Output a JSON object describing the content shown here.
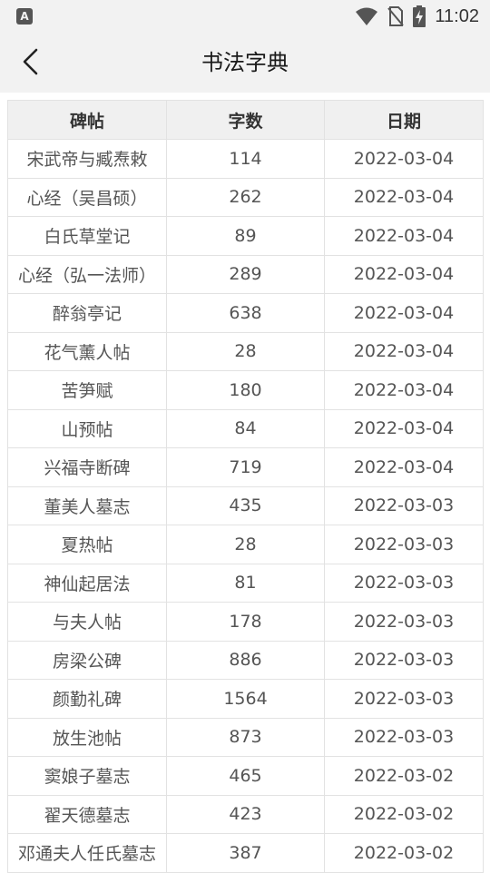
{
  "status_bar": {
    "app_badge": "A",
    "time": "11:02"
  },
  "header": {
    "title": "书法字典"
  },
  "table": {
    "columns": [
      "碑帖",
      "字数",
      "日期"
    ],
    "rows": [
      [
        "宋武帝与臧焘敕",
        "114",
        "2022-03-04"
      ],
      [
        "心经（吴昌硕）",
        "262",
        "2022-03-04"
      ],
      [
        "白氏草堂记",
        "89",
        "2022-03-04"
      ],
      [
        "心经（弘一法师）",
        "289",
        "2022-03-04"
      ],
      [
        "醉翁亭记",
        "638",
        "2022-03-04"
      ],
      [
        "花气薰人帖",
        "28",
        "2022-03-04"
      ],
      [
        "苦笋赋",
        "180",
        "2022-03-04"
      ],
      [
        "山预帖",
        "84",
        "2022-03-04"
      ],
      [
        "兴福寺断碑",
        "719",
        "2022-03-04"
      ],
      [
        "董美人墓志",
        "435",
        "2022-03-03"
      ],
      [
        "夏热帖",
        "28",
        "2022-03-03"
      ],
      [
        "神仙起居法",
        "81",
        "2022-03-03"
      ],
      [
        "与夫人帖",
        "178",
        "2022-03-03"
      ],
      [
        "房梁公碑",
        "886",
        "2022-03-03"
      ],
      [
        "颜勤礼碑",
        "1564",
        "2022-03-03"
      ],
      [
        "放生池帖",
        "873",
        "2022-03-03"
      ],
      [
        "窦娘子墓志",
        "465",
        "2022-03-02"
      ],
      [
        "翟天德墓志",
        "423",
        "2022-03-02"
      ],
      [
        "邓通夫人任氏墓志",
        "387",
        "2022-03-02"
      ]
    ]
  }
}
